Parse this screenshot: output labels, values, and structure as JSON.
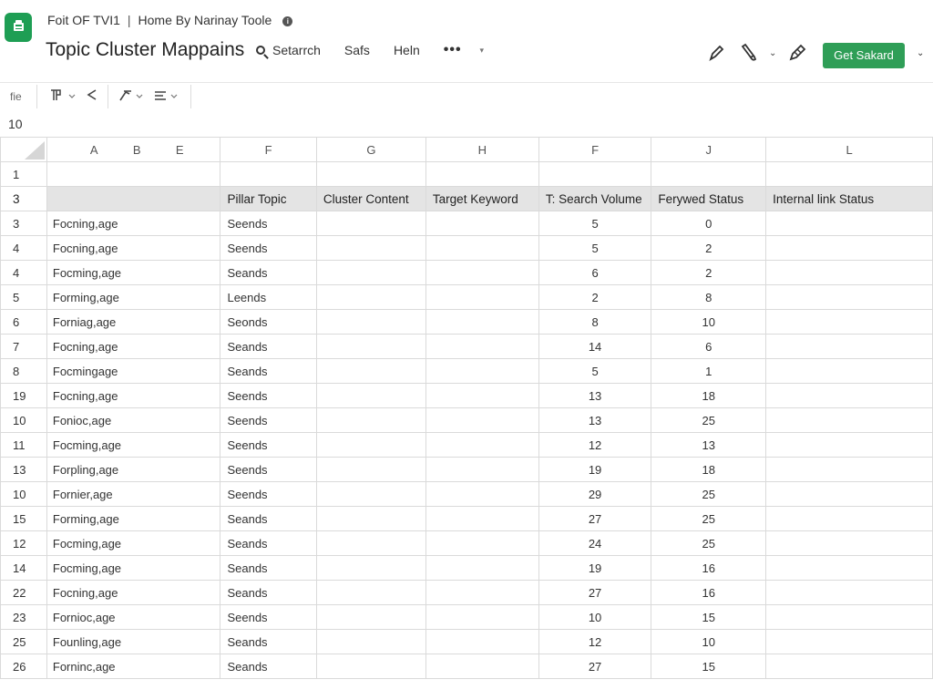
{
  "header": {
    "breadcrumb": [
      "Foit OF TVI1",
      "Home By Narinay Toole"
    ],
    "title": "Topic Cluster Mappains",
    "menu": [
      "Setarrch",
      "Safs",
      "Heln"
    ],
    "cta_label": "Get Sakard"
  },
  "toolbar": {
    "label": "fie"
  },
  "cell_ref": "10",
  "grid": {
    "columns": [
      "A",
      "B",
      "E",
      "F",
      "G",
      "H",
      "F",
      "J",
      "L"
    ],
    "blank_row_label": "1",
    "header_row": {
      "label": "3",
      "cells": [
        "Pillar Topic",
        "Cluster Content",
        "Target Keyword",
        "T: Search Volume",
        "Ferywed Status",
        "Internal link Status"
      ]
    },
    "rows": [
      {
        "label": "3",
        "name": "Focning,age",
        "topic": "Seends",
        "volume": "5",
        "status": "0"
      },
      {
        "label": "4",
        "name": "Focning,age",
        "topic": "Seends",
        "volume": "5",
        "status": "2"
      },
      {
        "label": "4",
        "name": "Focming,age",
        "topic": "Seands",
        "volume": "6",
        "status": "2"
      },
      {
        "label": "5",
        "name": "Forming,age",
        "topic": "Leends",
        "volume": "2",
        "status": "8"
      },
      {
        "label": "6",
        "name": "Forniag,age",
        "topic": "Seonds",
        "volume": "8",
        "status": "10"
      },
      {
        "label": "7",
        "name": "Focning,age",
        "topic": "Seands",
        "volume": "14",
        "status": "6"
      },
      {
        "label": "8",
        "name": "Focmingage",
        "topic": "Seands",
        "volume": "5",
        "status": "1"
      },
      {
        "label": "19",
        "name": "Focning,age",
        "topic": "Seends",
        "volume": "13",
        "status": "18"
      },
      {
        "label": "10",
        "name": "Fonioc,age",
        "topic": "Seends",
        "volume": "13",
        "status": "25"
      },
      {
        "label": "11",
        "name": "Focming,age",
        "topic": "Seends",
        "volume": "12",
        "status": "13"
      },
      {
        "label": "13",
        "name": "Forpling,age",
        "topic": "Seends",
        "volume": "19",
        "status": "18"
      },
      {
        "label": "10",
        "name": "Fornier,age",
        "topic": "Seends",
        "volume": "29",
        "status": "25"
      },
      {
        "label": "15",
        "name": "Forming,age",
        "topic": "Seands",
        "volume": "27",
        "status": "25"
      },
      {
        "label": "12",
        "name": "Focming,age",
        "topic": "Seands",
        "volume": "24",
        "status": "25"
      },
      {
        "label": "14",
        "name": "Focming,age",
        "topic": "Seands",
        "volume": "19",
        "status": "16"
      },
      {
        "label": "22",
        "name": "Focning,age",
        "topic": "Seands",
        "volume": "27",
        "status": "16"
      },
      {
        "label": "23",
        "name": "Fornioc,age",
        "topic": "Seends",
        "volume": "10",
        "status": "15"
      },
      {
        "label": "25",
        "name": "Founling,age",
        "topic": "Seands",
        "volume": "12",
        "status": "10"
      },
      {
        "label": "26",
        "name": "Forninc,age",
        "topic": "Seands",
        "volume": "27",
        "status": "15"
      }
    ]
  },
  "colors": {
    "accent": "#2f9e57",
    "header_fill": "#e4e4e4"
  },
  "icons": [
    "sheets-logo-icon",
    "info-icon",
    "search-icon",
    "more-icon",
    "pen-icon",
    "brush-icon",
    "pencil-icon",
    "chevron-down-icon",
    "share-icon",
    "format-icon",
    "align-icon"
  ]
}
